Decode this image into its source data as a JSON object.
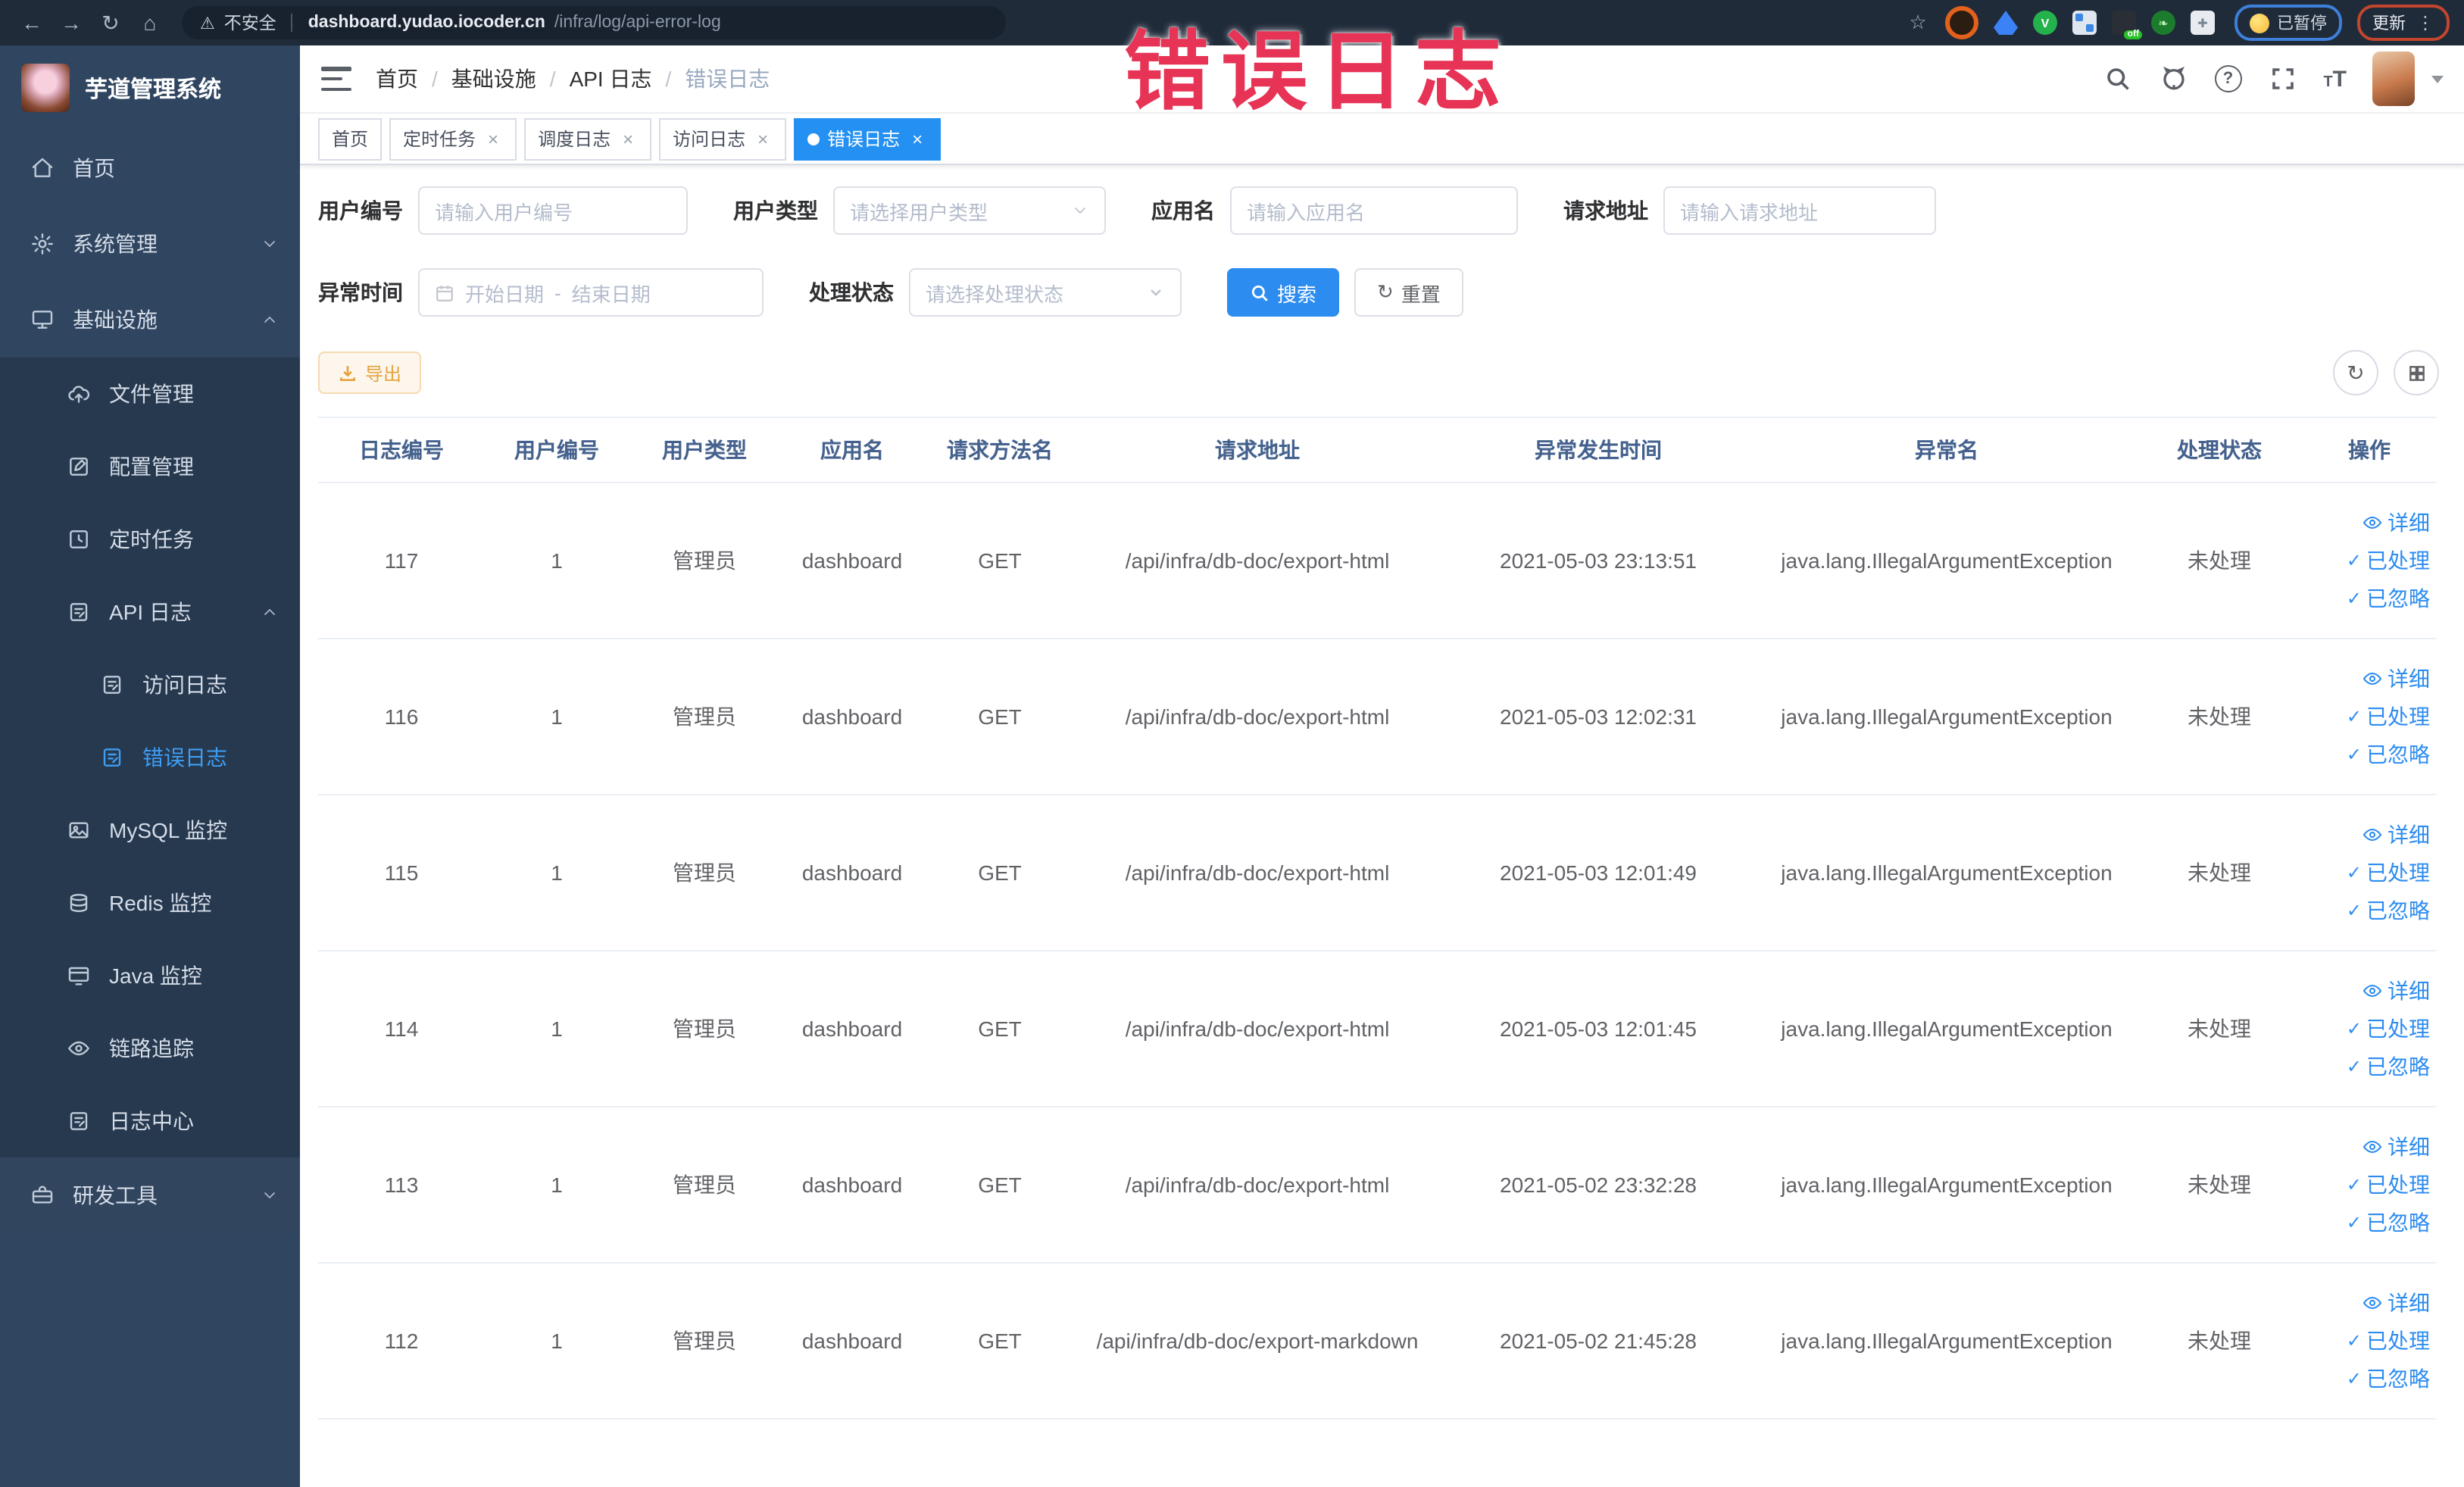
{
  "annotation": {
    "text": "错误日志"
  },
  "browser": {
    "back": "←",
    "forward": "→",
    "reload": "↻",
    "home": "⌂",
    "security_label": "不安全",
    "url_host": "dashboard.yudao.iocoder.cn",
    "url_path": "/infra/log/api-error-log",
    "star": "☆",
    "paused_label": "已暂停",
    "update_label": "更新",
    "menu_dots": "⋮"
  },
  "sidebar": {
    "title": "芋道管理系统",
    "menu": [
      {
        "label": "首页",
        "icon": "home-icon",
        "depth": 0
      },
      {
        "label": "系统管理",
        "icon": "gear-icon",
        "depth": 0,
        "chevron": "down"
      },
      {
        "label": "基础设施",
        "icon": "infrastructure-icon",
        "depth": 0,
        "chevron": "up"
      },
      {
        "label": "文件管理",
        "icon": "file-manage-icon",
        "depth": 1
      },
      {
        "label": "配置管理",
        "icon": "config-manage-icon",
        "depth": 1
      },
      {
        "label": "定时任务",
        "icon": "scheduled-job-icon",
        "depth": 1
      },
      {
        "label": "API 日志",
        "icon": "api-log-icon",
        "depth": 1,
        "chevron": "up"
      },
      {
        "label": "访问日志",
        "icon": "access-log-icon",
        "depth": 2
      },
      {
        "label": "错误日志",
        "icon": "error-log-icon",
        "depth": 2,
        "active": true
      },
      {
        "label": "MySQL 监控",
        "icon": "mysql-monitor-icon",
        "depth": 1
      },
      {
        "label": "Redis 监控",
        "icon": "redis-monitor-icon",
        "depth": 1
      },
      {
        "label": "Java 监控",
        "icon": "java-monitor-icon",
        "depth": 1
      },
      {
        "label": "链路追踪",
        "icon": "trace-icon",
        "depth": 1
      },
      {
        "label": "日志中心",
        "icon": "log-center-icon",
        "depth": 1
      },
      {
        "label": "研发工具",
        "icon": "devtools-icon",
        "depth": 0,
        "chevron": "down",
        "section": "bottom"
      }
    ]
  },
  "breadcrumb": [
    "首页",
    "基础设施",
    "API 日志",
    "错误日志"
  ],
  "tags": [
    {
      "label": "首页",
      "closable": false,
      "active": false
    },
    {
      "label": "定时任务",
      "closable": true,
      "active": false
    },
    {
      "label": "调度日志",
      "closable": true,
      "active": false
    },
    {
      "label": "访问日志",
      "closable": true,
      "active": false
    },
    {
      "label": "错误日志",
      "closable": true,
      "active": true
    }
  ],
  "filters": {
    "row1": [
      {
        "label": "用户编号",
        "type": "input",
        "placeholder": "请输入用户编号"
      },
      {
        "label": "用户类型",
        "type": "select",
        "placeholder": "请选择用户类型"
      },
      {
        "label": "应用名",
        "type": "input",
        "placeholder": "请输入应用名"
      },
      {
        "label": "请求地址",
        "type": "input",
        "placeholder": "请输入请求地址"
      }
    ],
    "time_label": "异常时间",
    "date_start_placeholder": "开始日期",
    "date_separator": "-",
    "date_end_placeholder": "结束日期",
    "status_label": "处理状态",
    "status_placeholder": "请选择处理状态",
    "search_label": "搜索",
    "reset_label": "重置"
  },
  "toolbar": {
    "export_label": "导出"
  },
  "table": {
    "headers": [
      "日志编号",
      "用户编号",
      "用户类型",
      "应用名",
      "请求方法名",
      "请求地址",
      "异常发生时间",
      "异常名",
      "处理状态",
      "操作"
    ],
    "actions": [
      "详细",
      "已处理",
      "已忽略"
    ],
    "rows": [
      {
        "id": "117",
        "user_id": "1",
        "user_type": "管理员",
        "app": "dashboard",
        "method": "GET",
        "url": "/api/infra/db-doc/export-html",
        "time": "2021-05-03 23:13:51",
        "exception": "java.lang.IllegalArgumentException",
        "status": "未处理"
      },
      {
        "id": "116",
        "user_id": "1",
        "user_type": "管理员",
        "app": "dashboard",
        "method": "GET",
        "url": "/api/infra/db-doc/export-html",
        "time": "2021-05-03 12:02:31",
        "exception": "java.lang.IllegalArgumentException",
        "status": "未处理"
      },
      {
        "id": "115",
        "user_id": "1",
        "user_type": "管理员",
        "app": "dashboard",
        "method": "GET",
        "url": "/api/infra/db-doc/export-html",
        "time": "2021-05-03 12:01:49",
        "exception": "java.lang.IllegalArgumentException",
        "status": "未处理"
      },
      {
        "id": "114",
        "user_id": "1",
        "user_type": "管理员",
        "app": "dashboard",
        "method": "GET",
        "url": "/api/infra/db-doc/export-html",
        "time": "2021-05-03 12:01:45",
        "exception": "java.lang.IllegalArgumentException",
        "status": "未处理"
      },
      {
        "id": "113",
        "user_id": "1",
        "user_type": "管理员",
        "app": "dashboard",
        "method": "GET",
        "url": "/api/infra/db-doc/export-html",
        "time": "2021-05-02 23:32:28",
        "exception": "java.lang.IllegalArgumentException",
        "status": "未处理"
      },
      {
        "id": "112",
        "user_id": "1",
        "user_type": "管理员",
        "app": "dashboard",
        "method": "GET",
        "url": "/api/infra/db-doc/export-markdown",
        "time": "2021-05-02 21:45:28",
        "exception": "java.lang.IllegalArgumentException",
        "status": "未处理"
      }
    ]
  },
  "colors": {
    "primary": "#2d8cf0",
    "active_tab": "#2490f1",
    "sidebar_active": "#3d9ef5",
    "warning": "#e6a23c",
    "annotation": "#e73355"
  }
}
